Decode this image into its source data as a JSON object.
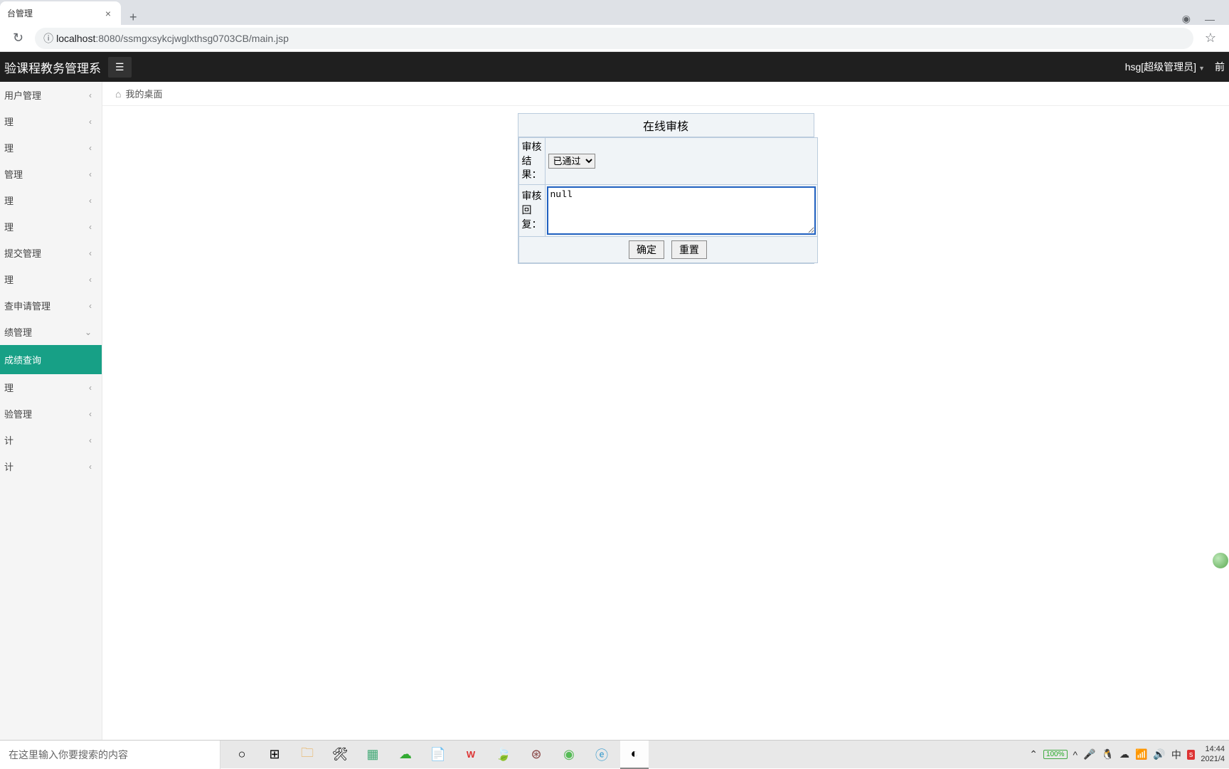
{
  "browser": {
    "tab_title": "台管理",
    "url_proto": "ⓘ",
    "url_host": "localhost",
    "url_port_path": ":8080/ssmgxsykcjwglxthsg0703CB/main.jsp"
  },
  "header": {
    "app_title": "验课程教务管理系",
    "user_label": "hsg[超级管理员]",
    "front_link": "前"
  },
  "sidebar": {
    "items": [
      {
        "label": "用户管理",
        "expanded": false
      },
      {
        "label": "理",
        "expanded": false
      },
      {
        "label": "理",
        "expanded": false
      },
      {
        "label": "管理",
        "expanded": false
      },
      {
        "label": "理",
        "expanded": false
      },
      {
        "label": "理",
        "expanded": false
      },
      {
        "label": "提交管理",
        "expanded": false
      },
      {
        "label": "理",
        "expanded": false
      },
      {
        "label": "查申请管理",
        "expanded": false
      },
      {
        "label": "绩管理",
        "expanded": true,
        "sub": "成绩查询"
      },
      {
        "label": "理",
        "expanded": false
      },
      {
        "label": "验管理",
        "expanded": false
      },
      {
        "label": "计",
        "expanded": false
      },
      {
        "label": "计",
        "expanded": false
      }
    ]
  },
  "breadcrumb": {
    "label": "我的桌面"
  },
  "panel": {
    "title": "在线审核",
    "row1_label": "审核结果：",
    "row1_option": "已通过",
    "row2_label": "审核回复：",
    "row2_value": "null",
    "btn_ok": "确定",
    "btn_reset": "重置"
  },
  "taskbar": {
    "search_placeholder": "在这里输入你要搜索的内容",
    "time": "14:44",
    "date": "2021/4",
    "battery": "100%"
  }
}
